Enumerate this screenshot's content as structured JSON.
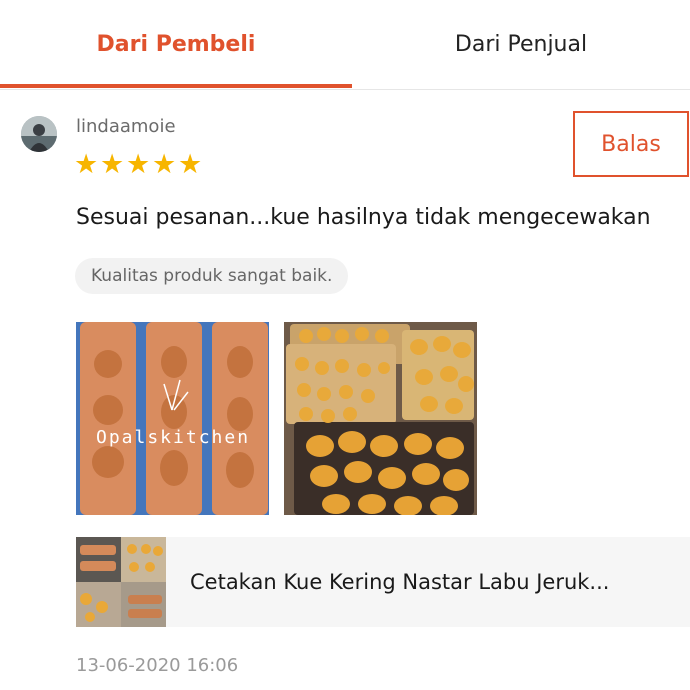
{
  "tabs": [
    {
      "label": "Dari Pembeli",
      "active": true
    },
    {
      "label": "Dari Penjual",
      "active": false
    }
  ],
  "review": {
    "username": "lindaamoie",
    "rating": 5,
    "rating_max": 5,
    "reply_label": "Balas",
    "text": "Sesuai pesanan...kue hasilnya tidak mengecewakan",
    "tag": "Kualitas produk sangat baik.",
    "photo_watermark": "Opalskitchen",
    "product_name": "Cetakan Kue Kering Nastar Labu Jeruk...",
    "timestamp": "13-06-2020 16:06"
  },
  "colors": {
    "accent": "#e0522d",
    "star": "#f7b500",
    "tag_bg": "#f2f2f2",
    "product_bg": "#f6f6f6"
  },
  "icons": [
    "avatar",
    "star-icon",
    "mold-photo",
    "cookie-photo",
    "product-thumbnail"
  ]
}
